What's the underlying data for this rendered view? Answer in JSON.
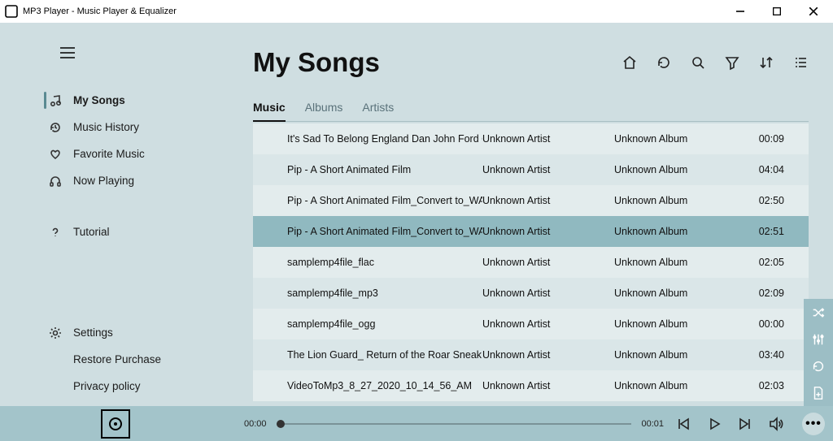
{
  "window": {
    "title": "MP3 Player - Music Player & Equalizer"
  },
  "sidebar": {
    "items": [
      {
        "label": "My Songs"
      },
      {
        "label": "Music History"
      },
      {
        "label": "Favorite Music"
      },
      {
        "label": "Now Playing"
      }
    ],
    "tutorial": "Tutorial",
    "bottom": [
      {
        "label": "Settings"
      },
      {
        "label": "Restore Purchase"
      },
      {
        "label": "Privacy policy"
      }
    ]
  },
  "page": {
    "title": "My Songs"
  },
  "tabs": [
    {
      "label": "Music",
      "active": true
    },
    {
      "label": "Albums"
    },
    {
      "label": "Artists"
    }
  ],
  "songs": [
    {
      "title": "It's Sad To Belong  England Dan  John Ford Coley KARAO",
      "artist": "Unknown Artist",
      "album": "Unknown Album",
      "duration": "00:09"
    },
    {
      "title": "Pip - A Short Animated Film",
      "artist": "Unknown Artist",
      "album": "Unknown Album",
      "duration": "04:04"
    },
    {
      "title": "Pip - A Short Animated Film_Convert to_WAV",
      "artist": "Unknown Artist",
      "album": "Unknown Album",
      "duration": "02:50"
    },
    {
      "title": "Pip - A Short Animated Film_Convert to_WAV_Convert to",
      "artist": "Unknown Artist",
      "album": "Unknown Album",
      "duration": "02:51",
      "selected": true
    },
    {
      "title": "samplemp4file_flac",
      "artist": "Unknown Artist",
      "album": "Unknown Album",
      "duration": "02:05"
    },
    {
      "title": "samplemp4file_mp3",
      "artist": "Unknown Artist",
      "album": "Unknown Album",
      "duration": "02:09"
    },
    {
      "title": "samplemp4file_ogg",
      "artist": "Unknown Artist",
      "album": "Unknown Album",
      "duration": "00:00"
    },
    {
      "title": "The Lion Guard_ Return of the Roar Sneak Peek _ Official",
      "artist": "Unknown Artist",
      "album": "Unknown Album",
      "duration": "03:40"
    },
    {
      "title": "VideoToMp3_8_27_2020_10_14_56_AM",
      "artist": "Unknown Artist",
      "album": "Unknown Album",
      "duration": "02:03"
    }
  ],
  "playbar": {
    "elapsed": "00:00",
    "total": "00:01",
    "more": "•••"
  }
}
